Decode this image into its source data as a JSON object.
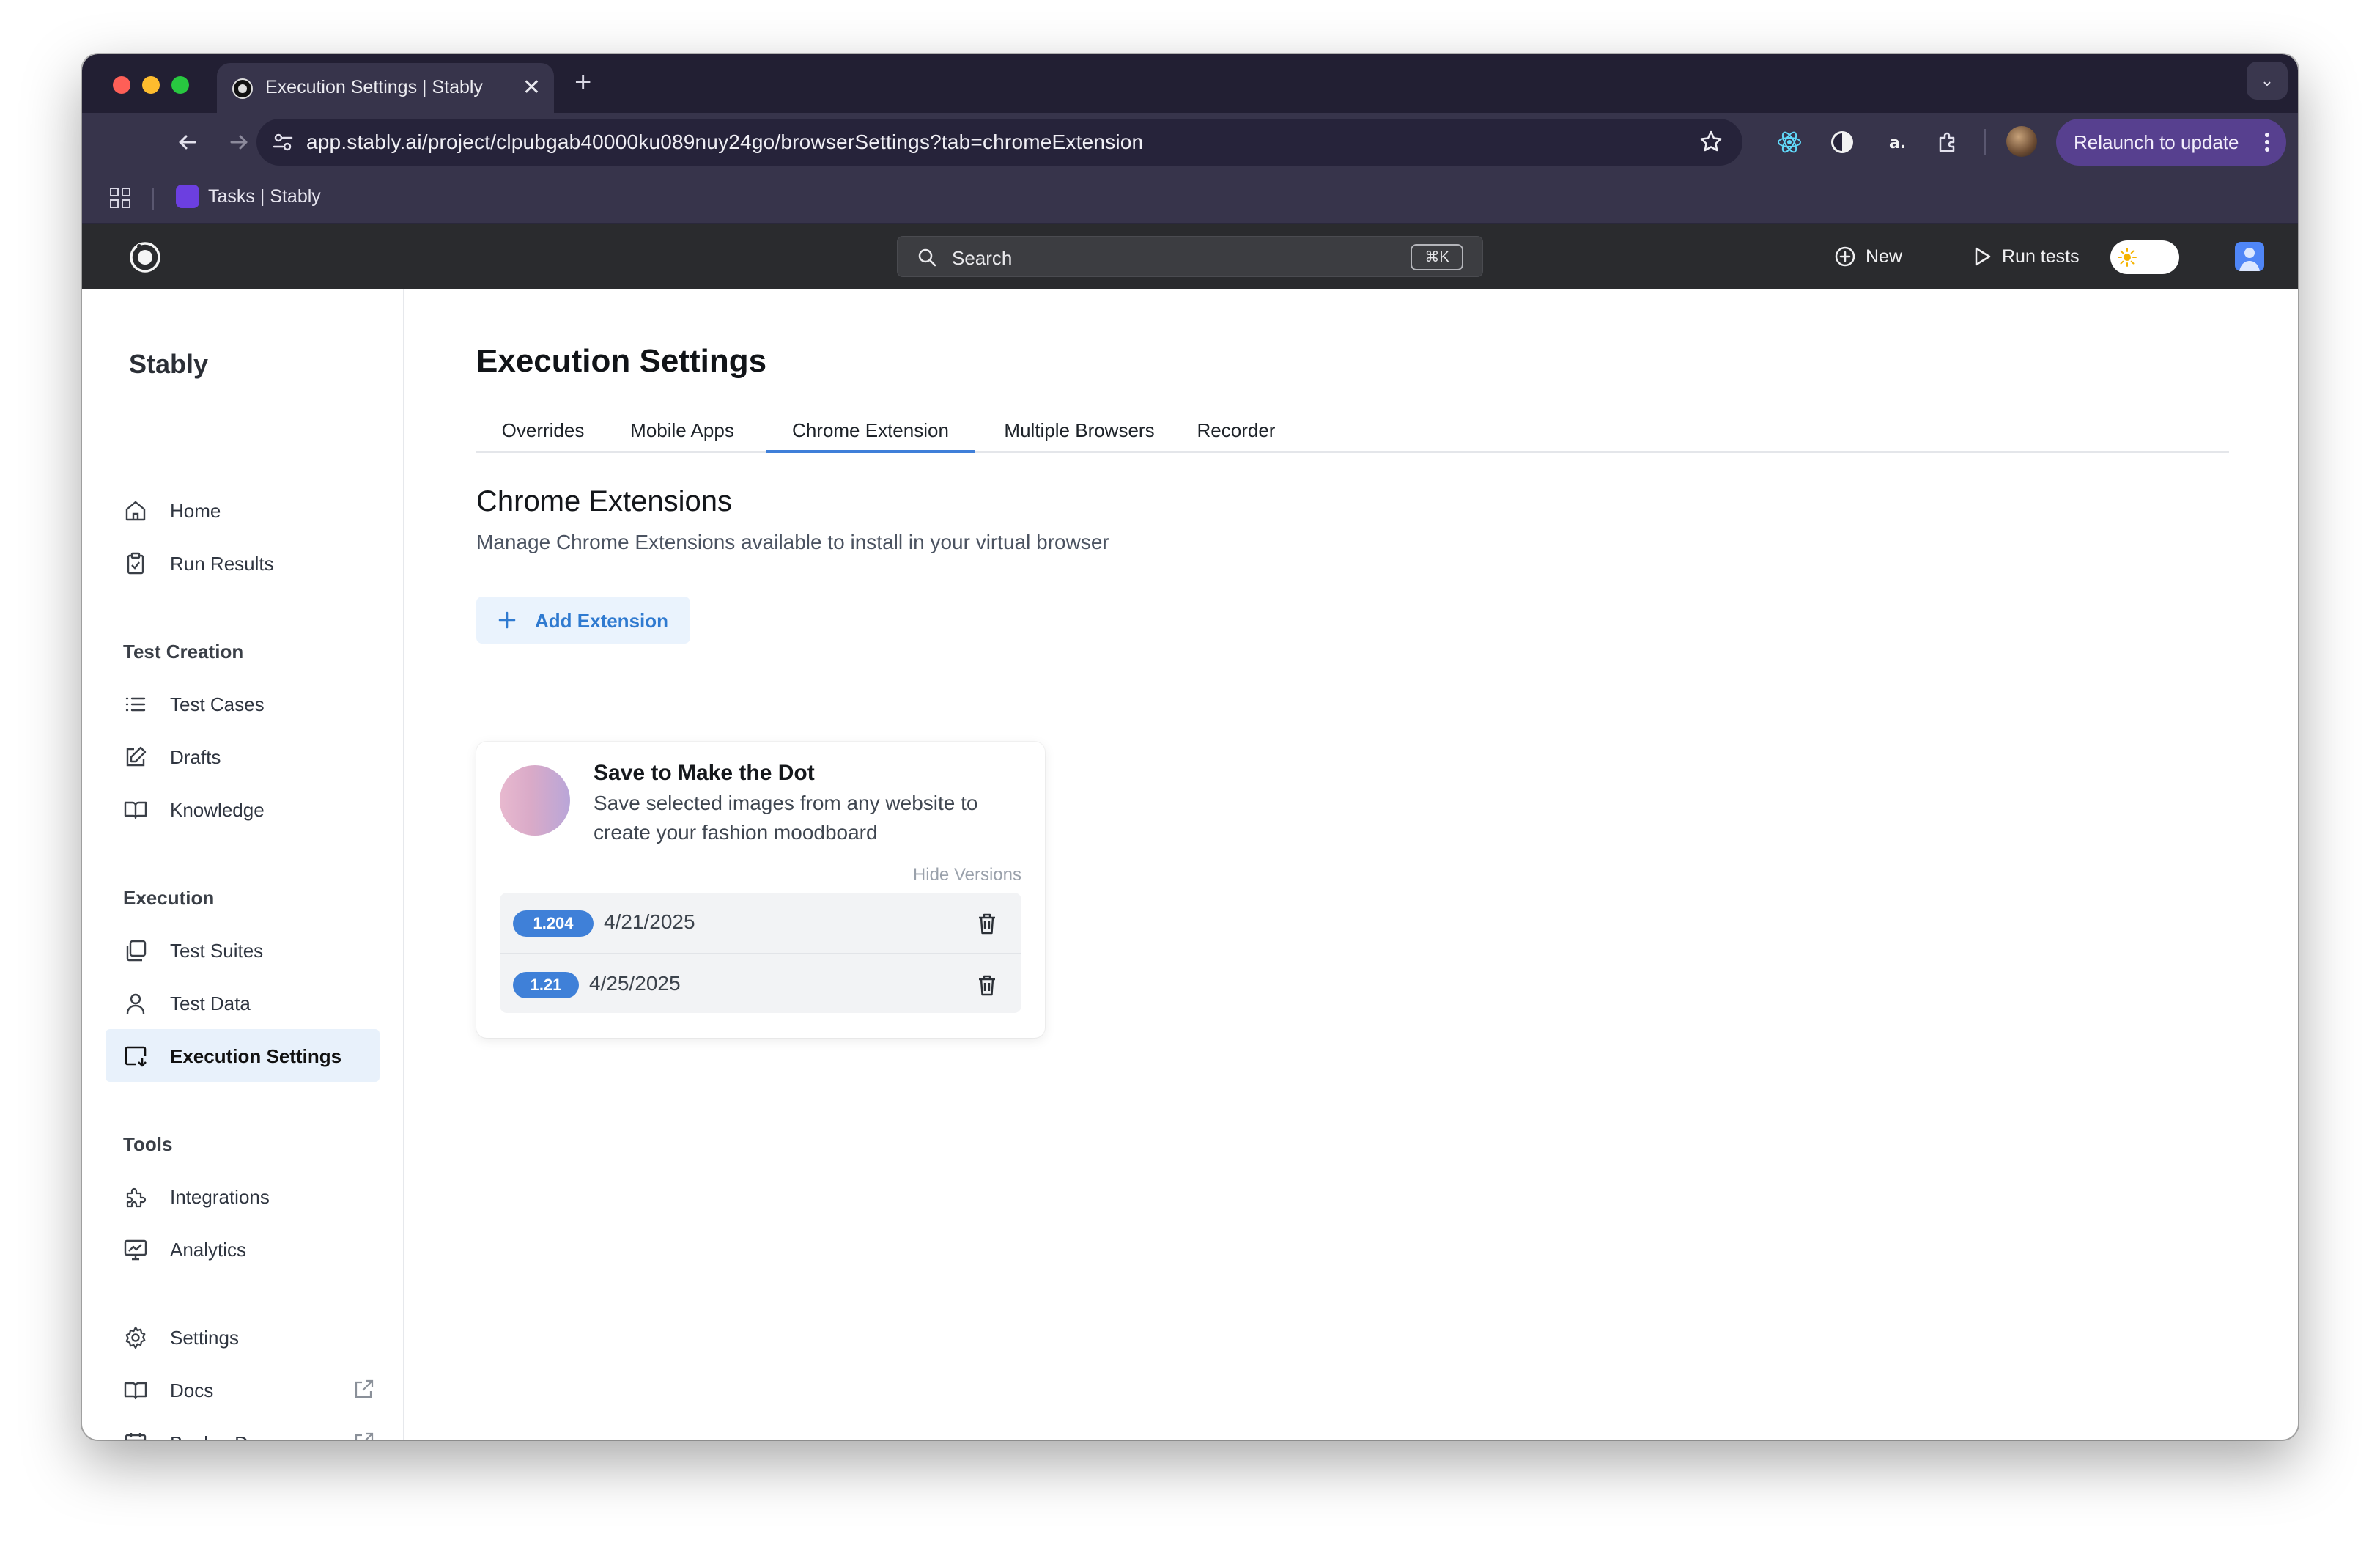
{
  "browser": {
    "tab_title": "Execution Settings | Stably",
    "url": "app.stably.ai/project/clpubgab40000ku089nuy24go/browserSettings?tab=chromeExtension",
    "relaunch_label": "Relaunch to update",
    "bookmark_label": "Tasks | Stably"
  },
  "header": {
    "search_placeholder": "Search",
    "search_shortcut": "⌘K",
    "new_label": "New",
    "run_tests_label": "Run tests"
  },
  "sidebar": {
    "brand": "Stably",
    "items_top": [
      {
        "label": "Home",
        "icon": "home-icon"
      },
      {
        "label": "Run Results",
        "icon": "clipboard-icon"
      }
    ],
    "sections": {
      "test_creation": "Test Creation",
      "execution": "Execution",
      "tools": "Tools"
    },
    "test_creation": [
      {
        "label": "Test Cases",
        "icon": "list-icon"
      },
      {
        "label": "Drafts",
        "icon": "pencil-icon"
      },
      {
        "label": "Knowledge",
        "icon": "book-icon"
      }
    ],
    "execution": [
      {
        "label": "Test Suites",
        "icon": "copy-icon"
      },
      {
        "label": "Test Data",
        "icon": "user-icon"
      },
      {
        "label": "Execution Settings",
        "icon": "monitor-download-icon",
        "active": true
      }
    ],
    "tools": [
      {
        "label": "Integrations",
        "icon": "puzzle-icon"
      },
      {
        "label": "Analytics",
        "icon": "chart-monitor-icon"
      }
    ],
    "bottom": [
      {
        "label": "Settings",
        "icon": "gear-icon"
      },
      {
        "label": "Docs",
        "icon": "book-icon"
      },
      {
        "label": "Book a Demo",
        "icon": "calendar-icon"
      }
    ]
  },
  "main": {
    "title": "Execution Settings",
    "tabs": [
      "Overrides",
      "Mobile Apps",
      "Chrome Extension",
      "Multiple Browsers",
      "Recorder"
    ],
    "active_tab": "Chrome Extension",
    "section_title": "Chrome Extensions",
    "section_subtitle": "Manage Chrome Extensions available to install in your virtual browser",
    "add_button": "Add Extension",
    "extension": {
      "name": "Save to Make the Dot",
      "description": "Save selected images from any website to create your fashion moodboard",
      "hide_versions": "Hide Versions",
      "versions": [
        {
          "version": "1.204",
          "date": "4/21/2025"
        },
        {
          "version": "1.21",
          "date": "4/25/2025"
        }
      ]
    }
  },
  "colors": {
    "accent": "#3f7fd9",
    "active_bg": "#e8f1fb",
    "relaunch": "#57408f",
    "appbar": "#2a2b2e"
  }
}
